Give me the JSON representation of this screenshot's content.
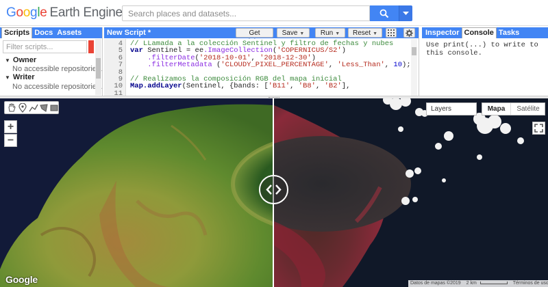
{
  "app": {
    "logo_google": "Google",
    "logo_product": "Earth Engine"
  },
  "search": {
    "placeholder": "Search places and datasets..."
  },
  "left_panel": {
    "tabs": [
      "Scripts",
      "Docs",
      "Assets"
    ],
    "active_tab": "Scripts",
    "filter_placeholder": "Filter scripts...",
    "groups": [
      {
        "label": "Owner",
        "sub": "No accessible repositories."
      },
      {
        "label": "Writer",
        "sub": "No accessible repositories."
      }
    ]
  },
  "editor": {
    "title": "New Script *",
    "buttons": {
      "get_link": "Get Link",
      "save": "Save",
      "run": "Run",
      "reset": "Reset"
    },
    "line_numbers": [
      "4",
      "5",
      "6",
      "7",
      "8",
      "9",
      "10",
      "11"
    ],
    "code_lines": [
      "// LLamada a la colección Sentinel y filtro de fechas y nubes",
      "var Sentinel = ee.ImageCollection('COPERNICUS/S2')",
      "    .filterDate('2018-10-01', '2018-12-30')",
      "    .filterMetadata ('CLOUDY_PIXEL_PERCENTAGE', 'Less_Than', 10);",
      "",
      "// Realizamos la composición RGB del mapa inicial",
      "Map.addLayer(Sentinel, {bands: ['B11', 'B8', 'B2'],",
      ""
    ]
  },
  "right_panel": {
    "tabs": [
      "Inspector",
      "Console",
      "Tasks"
    ],
    "active_tab": "Console",
    "console_text": "Use print(...) to write to this console."
  },
  "map": {
    "layers_label": "Layers",
    "map_type_options": [
      "Mapa",
      "Satélite"
    ],
    "map_type_selected": "Mapa",
    "watermark": "Google",
    "attribution": {
      "data": "Datos de mapas ©2019",
      "scale": "2 km",
      "terms": "Términos de uso"
    }
  },
  "icons": {
    "search": "search-icon",
    "dropdown": "chevron-down-icon",
    "apps": "grid-icon",
    "settings": "gear-icon",
    "hand": "hand-icon",
    "marker": "marker-icon",
    "line": "line-icon",
    "polygon": "polygon-icon",
    "rectangle": "rectangle-icon",
    "fullscreen": "fullscreen-icon",
    "swipe": "swipe-arrows-icon"
  },
  "colors": {
    "accent": "#4285f4",
    "flag": "#ea4335"
  }
}
